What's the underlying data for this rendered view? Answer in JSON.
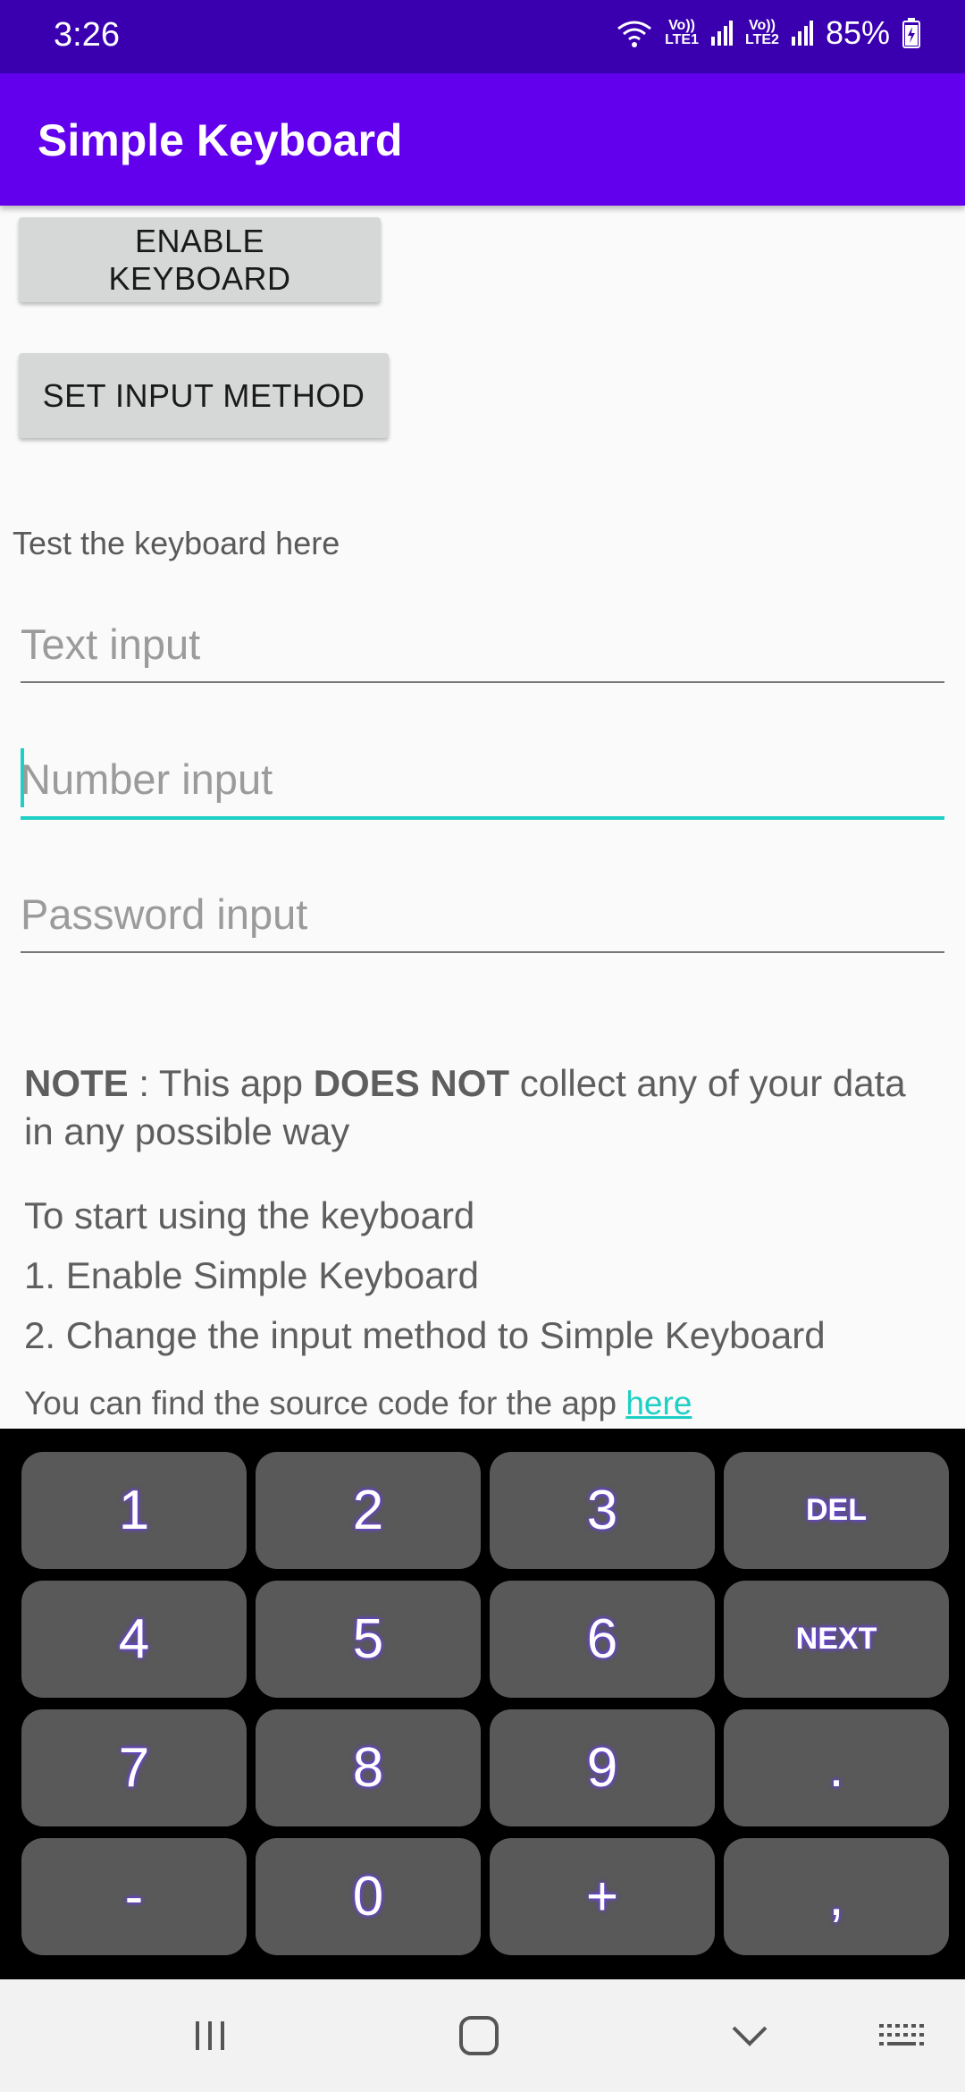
{
  "status": {
    "time": "3:26",
    "net1_top": "Vo))",
    "net1_bottom": "LTE1",
    "net2_top": "Vo))",
    "net2_bottom": "LTE2",
    "battery": "85%"
  },
  "app": {
    "title": "Simple Keyboard"
  },
  "buttons": {
    "enable": "ENABLE KEYBOARD",
    "set_input": "SET INPUT METHOD"
  },
  "test_label": "Test the keyboard here",
  "fields": {
    "text_placeholder": "Text input",
    "number_placeholder": "Number input",
    "password_placeholder": "Password input"
  },
  "note": {
    "bold1": "NOTE",
    "text1": " : This app ",
    "bold2": "DOES NOT",
    "text2": " collect any of your data in any possible way"
  },
  "steps": {
    "intro": "To start using the keyboard",
    "step1": "1. Enable Simple Keyboard",
    "step2": "2. Change the input method to Simple Keyboard"
  },
  "source": {
    "text": "You can find the source code for the app ",
    "link": "here"
  },
  "keyboard": {
    "keys": [
      "1",
      "2",
      "3",
      "DEL",
      "4",
      "5",
      "6",
      "NEXT",
      "7",
      "8",
      "9",
      ".",
      "-",
      "0",
      "+",
      ","
    ]
  },
  "colors": {
    "status_bar": "#3a00b0",
    "app_bar": "#6200ee",
    "accent": "#1ecfc4",
    "key": "#595959"
  },
  "navbar": {
    "icons": [
      "recents-icon",
      "home-icon",
      "back-icon",
      "keyboard-icon"
    ]
  }
}
